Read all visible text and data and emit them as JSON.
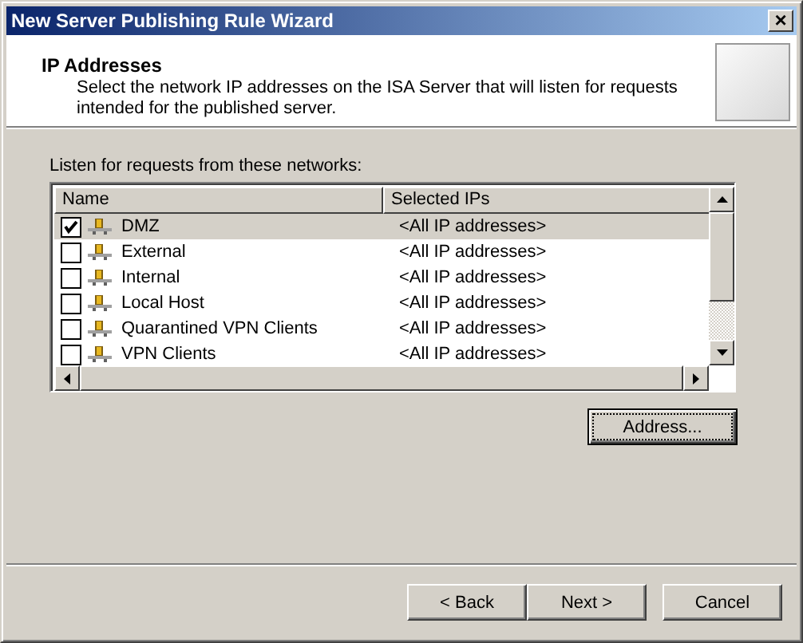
{
  "window": {
    "title": "New Server Publishing Rule Wizard",
    "close": "×"
  },
  "header": {
    "title": "IP Addresses",
    "description": "Select the network IP addresses on the ISA Server that will listen for requests intended for the published server."
  },
  "list_label": "Listen for requests from these networks:",
  "table": {
    "columns": [
      "Name",
      "Selected IPs"
    ],
    "rows": [
      {
        "name": "DMZ",
        "ips": "<All IP addresses>",
        "checked": true,
        "selected": true
      },
      {
        "name": "External",
        "ips": "<All IP addresses>",
        "checked": false,
        "selected": false
      },
      {
        "name": "Internal",
        "ips": "<All IP addresses>",
        "checked": false,
        "selected": false
      },
      {
        "name": "Local Host",
        "ips": "<All IP addresses>",
        "checked": false,
        "selected": false
      },
      {
        "name": "Quarantined VPN Clients",
        "ips": "<All IP addresses>",
        "checked": false,
        "selected": false
      },
      {
        "name": "VPN Clients",
        "ips": "<All IP addresses>",
        "checked": false,
        "selected": false
      }
    ]
  },
  "address_button": "Address...",
  "buttons": [
    "< Back",
    "Next >",
    "Cancel"
  ]
}
